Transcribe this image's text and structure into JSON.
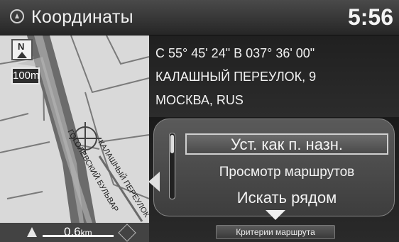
{
  "header": {
    "title": "Координаты",
    "clock": "5:56",
    "app_icon": "navigation-icon"
  },
  "map": {
    "north_label": "N",
    "scale_label": "100m",
    "distance_value": "0.6",
    "distance_unit": "km",
    "street_labels": [
      "ГОГОЛЕВСКИЙ БУЛЬВАР",
      "КАЛАШНЫЙ ПЕРЕУЛОК"
    ],
    "icons": [
      "north-up-icon",
      "position-arrow-icon",
      "compass-icon"
    ]
  },
  "location": {
    "coordinates": "С 55° 45' 24\" В 037° 36' 00\"",
    "address": "КАЛАШНЫЙ ПЕРЕУЛОК, 9",
    "city": "МОСКВА, RUS"
  },
  "menu": {
    "items": [
      {
        "label": "Уст. как п. назн.",
        "selected": true
      },
      {
        "label": "Просмотр маршрутов",
        "selected": false
      },
      {
        "label": "Искать рядом",
        "selected": false
      }
    ],
    "criteria_button": "Критерии маршрута"
  }
}
